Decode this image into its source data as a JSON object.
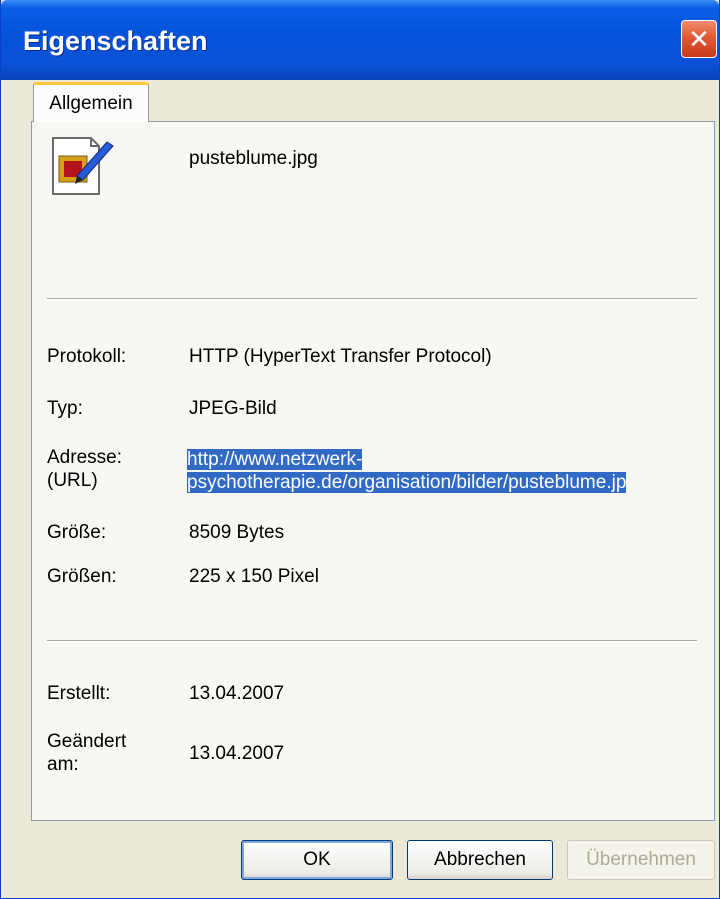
{
  "window": {
    "title": "Eigenschaften"
  },
  "tabs": [
    {
      "label": "Allgemein"
    }
  ],
  "file": {
    "name": "pusteblume.jpg",
    "icon": "jpeg-image-file-icon"
  },
  "properties": {
    "protocol_label": "Protokoll:",
    "protocol_value": "HTTP (HyperText Transfer Protocol)",
    "type_label": "Typ:",
    "type_value": "JPEG-Bild",
    "address_label_line1": "Adresse:",
    "address_label_line2": "(URL)",
    "address_value_line1": "http://www.netzwerk-",
    "address_value_line2": "psychotherapie.de/organisation/bilder/pusteblume.jp",
    "size_label": "Größe:",
    "size_value": "8509 Bytes",
    "dimensions_label": "Größen:",
    "dimensions_value": "225 x 150 Pixel"
  },
  "dates": {
    "created_label": "Erstellt:",
    "created_value": "13.04.2007",
    "modified_label_line1": "Geändert",
    "modified_label_line2": "am:",
    "modified_value": "13.04.2007"
  },
  "buttons": {
    "ok": "OK",
    "cancel": "Abbrechen",
    "apply": "Übernehmen"
  },
  "colors": {
    "titlebar": "#0453d9",
    "selection": "#316ac5",
    "tab_accent": "#ffc83c",
    "dialog_bg": "#ece9d8"
  }
}
